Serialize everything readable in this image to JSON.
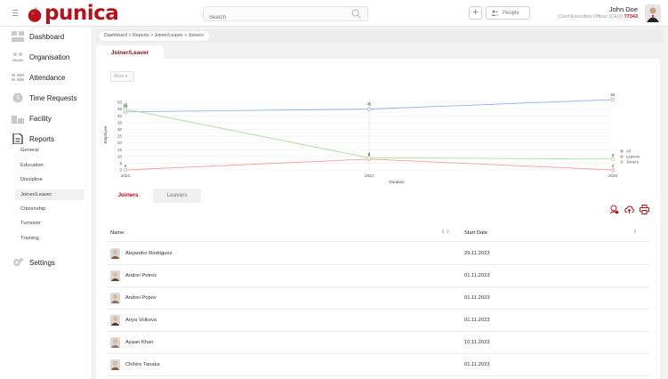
{
  "brand": {
    "name": "punica",
    "color": "#b5121b"
  },
  "topbar": {
    "search_placeholder": "Search",
    "plus_label": "+",
    "people_label": "People",
    "user_name": "John Doe",
    "user_role": "Chief Executive Officer (CEO)",
    "user_id": "77343"
  },
  "sidebar": {
    "items": [
      {
        "label": "Dashboard",
        "icon": "dashboard-icon"
      },
      {
        "label": "Organisation",
        "icon": "organisation-icon"
      },
      {
        "label": "Attendance",
        "icon": "attendance-icon"
      },
      {
        "label": "Time Requests",
        "icon": "clock-icon"
      },
      {
        "label": "Facility",
        "icon": "facility-icon"
      },
      {
        "label": "Reports",
        "icon": "reports-icon"
      },
      {
        "label": "Settings",
        "icon": "settings-icon"
      }
    ],
    "report_subitems": [
      "General",
      "Education",
      "Discipline",
      "Joiner/Leaver",
      "Citizenship",
      "Turnover",
      "Training"
    ],
    "active_subitem": "Joiner/Leaver"
  },
  "breadcrumb": "Dashboard  >  Reports  >  Joiner/Leaver  >  Joiners",
  "main_tab": "Joiner/Leaver",
  "more_label": "More",
  "chart_data": {
    "type": "line",
    "x": [
      "2022",
      "2024",
      "2026"
    ],
    "xlabel": "Duration",
    "ylabel": "Employee",
    "yticks": [
      0,
      5,
      10,
      15,
      20,
      25,
      30,
      35,
      40,
      45,
      50
    ],
    "series": [
      {
        "name": "All",
        "color": "#8fb4e3",
        "values": [
          43,
          45,
          52
        ]
      },
      {
        "name": "Leavers",
        "color": "#f3a09a",
        "values": [
          0,
          8,
          0
        ]
      },
      {
        "name": "Joiners",
        "color": "#a9dc97",
        "values": [
          45,
          9,
          8
        ]
      }
    ],
    "point_labels": [
      [
        "43",
        "45",
        "52"
      ],
      [
        "0",
        "8",
        "0"
      ],
      [
        "45",
        "9",
        "8"
      ]
    ],
    "legend": "right"
  },
  "subtabs": {
    "active": "Joiners",
    "inactive": "Leavers"
  },
  "table": {
    "columns": [
      "Name",
      "Start Date"
    ],
    "rows": [
      {
        "name": "Alejandro Rodriguez",
        "date": "29.11.2023"
      },
      {
        "name": "Andrei Petrov",
        "date": "01.11.2023"
      },
      {
        "name": "Andrei Popov",
        "date": "01.11.2023"
      },
      {
        "name": "Anya Volkova",
        "date": "01.11.2023"
      },
      {
        "name": "Ayaan Khan",
        "date": "10.11.2023"
      },
      {
        "name": "Chihiro Tanaka",
        "date": "01.11.2023"
      }
    ]
  }
}
